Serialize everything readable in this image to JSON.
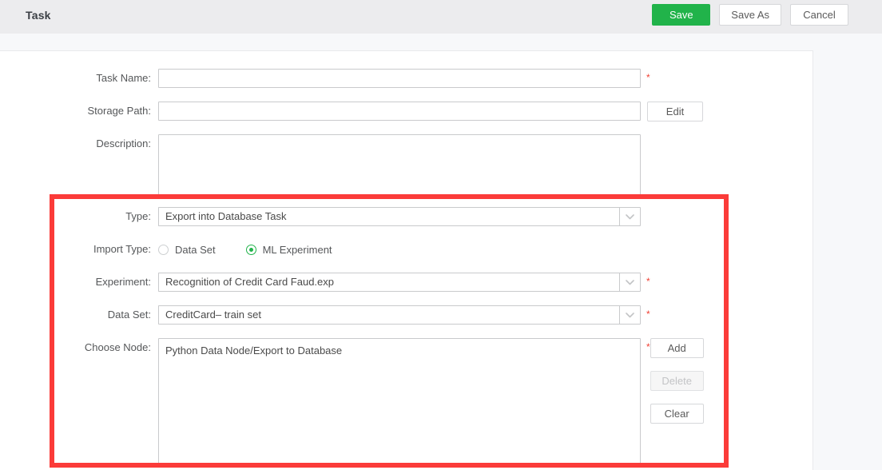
{
  "header": {
    "title": "Task",
    "buttons": [
      {
        "label": "Save",
        "kind": "primary",
        "name": "save-button"
      },
      {
        "label": "Save As",
        "kind": "default",
        "name": "save-as-button"
      },
      {
        "label": "Cancel",
        "kind": "default",
        "name": "cancel-button"
      }
    ]
  },
  "form": {
    "task_name": {
      "label": "Task Name:",
      "value": "",
      "placeholder": "",
      "required_marker": "*"
    },
    "storage_path": {
      "label": "Storage Path:",
      "value": "",
      "placeholder": "",
      "edit_button": "Edit"
    },
    "description": {
      "label": "Description:",
      "value": "",
      "placeholder": ""
    },
    "type": {
      "label": "Type:",
      "value": "Export into Database Task",
      "arrow_icon": "chevron-down-icon"
    },
    "import_type": {
      "label": "Import Type:",
      "options": [
        {
          "label": "Data Set",
          "selected": false
        },
        {
          "label": "ML Experiment",
          "selected": true
        }
      ]
    },
    "experiment": {
      "label": "Experiment:",
      "value": "Recognition of Credit Card Faud.exp",
      "arrow_icon": "chevron-down-icon",
      "required_marker": "*"
    },
    "data_set": {
      "label": "Data Set:",
      "value": "CreditCard– train set",
      "arrow_icon": "chevron-down-icon",
      "required_marker": "*"
    },
    "choose_node": {
      "label": "Choose Node:",
      "value": "Python Data Node/Export to Database",
      "required_marker": "*",
      "buttons": [
        {
          "label": "Add",
          "disabled": false,
          "name": "add-node-button"
        },
        {
          "label": "Delete",
          "disabled": true,
          "name": "delete-node-button"
        },
        {
          "label": "Clear",
          "disabled": false,
          "name": "clear-node-button"
        }
      ]
    }
  },
  "annotation": {
    "highlight_color": "#fb3b39"
  },
  "colors": {
    "primary_green": "#21b34a",
    "required_red": "#f04134",
    "header_bg": "#ececee",
    "page_bg": "#f7f8fa",
    "panel_bg": "#ffffff",
    "border": "#c9cacc"
  }
}
